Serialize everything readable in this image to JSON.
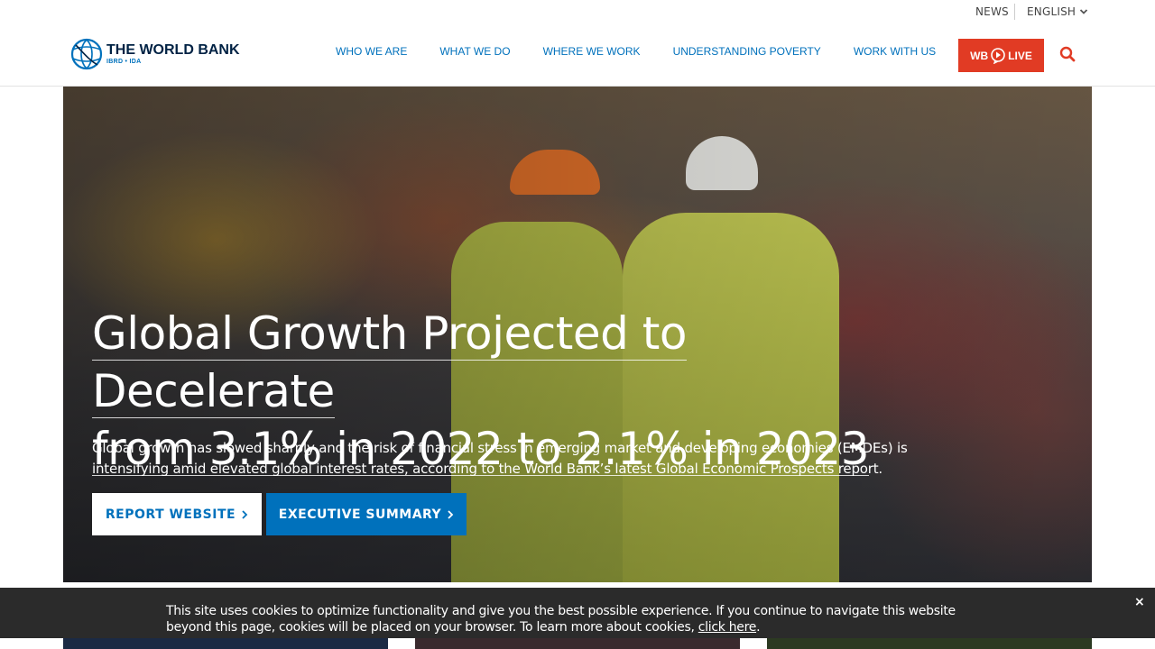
{
  "util": {
    "news": "NEWS",
    "language": "ENGLISH"
  },
  "logo": {
    "name": "THE WORLD BANK",
    "sub": "IBRD • IDA"
  },
  "nav": {
    "items": [
      {
        "label": "WHO WE ARE"
      },
      {
        "label": "WHAT WE DO"
      },
      {
        "label": "WHERE WE WORK"
      },
      {
        "label": "UNDERSTANDING POVERTY"
      },
      {
        "label": "WORK WITH US"
      }
    ],
    "live_label_prefix": "WB",
    "live_label_suffix": "LIVE"
  },
  "hero": {
    "title_line1": "Global Growth Projected to Decelerate",
    "title_line2": "from 3.1% in 2022 to 2.1% in 2023",
    "description": "Global growth has slowed sharply and the risk of financial stress in emerging market and developing economies (EMDEs) is intensifying amid elevated global interest rates, according to the World Bank’s latest Global Economic Prospects report.",
    "buttons": [
      {
        "label": "REPORT WEBSITE"
      },
      {
        "label": "EXECUTIVE SUMMARY"
      }
    ]
  },
  "cookie": {
    "text": "This site uses cookies to optimize functionality and give you the best possible experience. If you continue to navigate this website beyond this page, cookies will be placed on your browser. To learn more about cookies, ",
    "link": "click here",
    "tail": ".",
    "close": "×"
  },
  "colors": {
    "brand_blue": "#0071bc",
    "live_red": "#e13b24",
    "navy": "#002244",
    "banner": "#2b2b2b"
  },
  "icons": [
    "chevron-down-icon",
    "globe-logo-icon",
    "play-icon",
    "search-icon",
    "chevron-right-icon",
    "close-icon"
  ]
}
